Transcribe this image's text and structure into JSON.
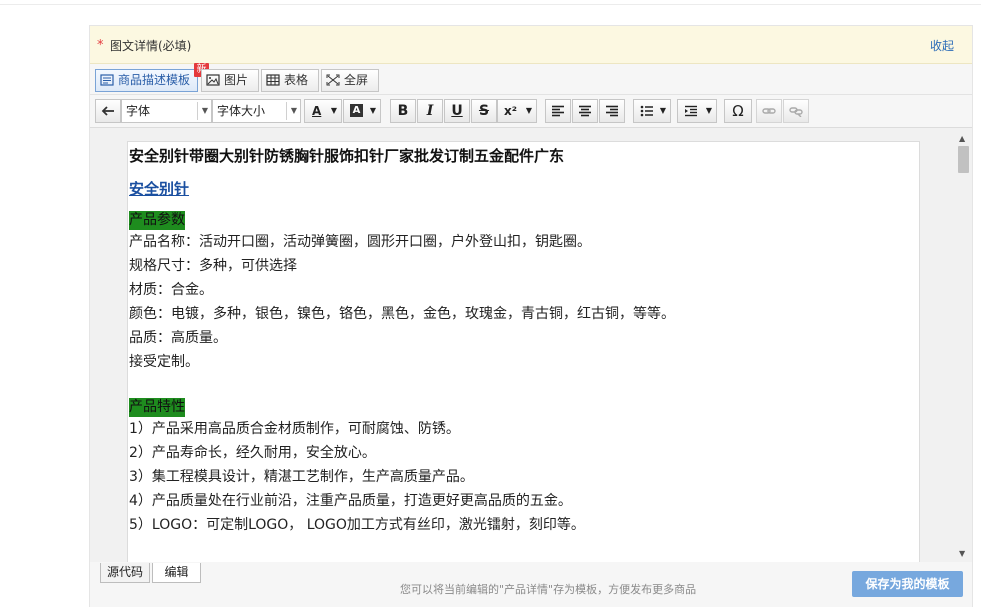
{
  "panel": {
    "required_mark": "*",
    "title": "图文详情(必填)",
    "collapse_label": "收起"
  },
  "tabs": [
    {
      "label": "商品描述模板",
      "icon": "template-icon",
      "active": true,
      "badge": "新"
    },
    {
      "label": "图片",
      "icon": "image-icon"
    },
    {
      "label": "表格",
      "icon": "table-icon"
    },
    {
      "label": "全屏",
      "icon": "fullscreen-icon"
    }
  ],
  "toolbar": {
    "undo_icon": "undo-icon",
    "font_family": "字体",
    "font_size": "字体大小",
    "font_color_glyph": "A",
    "bg_color_glyph": "A",
    "bold": "B",
    "italic": "I",
    "underline": "U",
    "strike": "S",
    "superscript": "x²",
    "special_char": "Ω"
  },
  "document": {
    "title": "安全别针带圈大别针防锈胸针服饰扣针厂家批发订制五金配件广东",
    "link": "安全别针",
    "section1_heading": "产品参数",
    "params": [
      "产品名称：活动开口圈，活动弹簧圈，圆形开口圈，户外登山扣，钥匙圈。",
      "规格尺寸：多种，可供选择",
      "材质：合金。",
      "颜色：电镀，多种，银色，镍色，铬色，黑色，金色，玫瑰金，青古铜，红古铜，等等。",
      "品质：高质量。",
      "接受定制。"
    ],
    "section2_heading": "产品特性",
    "features": [
      "1）产品采用高品质合金材质制作，可耐腐蚀、防锈。",
      "2）产品寿命长，经久耐用，安全放心。",
      "3）集工程模具设计，精湛工艺制作，生产高质量产品。",
      "4）产品质量处在行业前沿，注重产品质量，打造更好更高品质的五金。",
      "5）LOGO：可定制LOGO， LOGO加工方式有丝印，激光镭射，刻印等。"
    ]
  },
  "footer": {
    "source_tab": "源代码",
    "edit_tab": "编辑",
    "hint": "您可以将当前编辑的\"产品详情\"存为模板，方便发布更多商品",
    "save_button": "保存为我的模板"
  },
  "colors": {
    "accent": "#2b6cb8",
    "highlight": "#1e8c1e",
    "save_button": "#77a8de",
    "header_bg": "#fcf8e1"
  }
}
